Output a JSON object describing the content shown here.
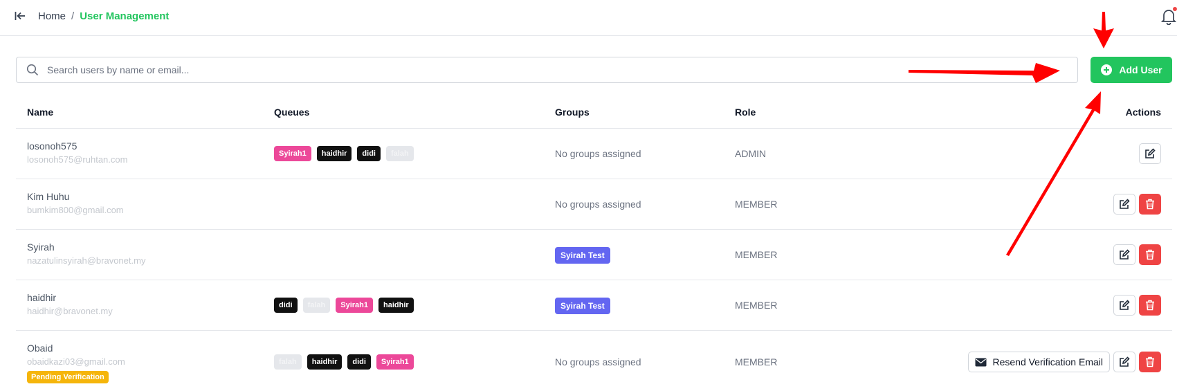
{
  "breadcrumb": {
    "home": "Home",
    "separator": "/",
    "current": "User Management"
  },
  "search": {
    "placeholder": "Search users by name or email..."
  },
  "add_user_label": "Add User",
  "columns": {
    "name": "Name",
    "queues": "Queues",
    "groups": "Groups",
    "role": "Role",
    "actions": "Actions"
  },
  "users": [
    {
      "name": "losonoh575",
      "email": "losonoh575@ruhtan.com",
      "queues": [
        "Syirah1",
        "haidhir",
        "didi",
        "falah"
      ],
      "groups": "No groups assigned",
      "role": "ADMIN"
    },
    {
      "name": "Kim Huhu",
      "email": "bumkim800@gmail.com",
      "queues": [],
      "groups": "No groups assigned",
      "role": "MEMBER"
    },
    {
      "name": "Syirah",
      "email": "nazatulinsyirah@bravonet.my",
      "queues": [],
      "groups": "Syirah Test",
      "role": "MEMBER"
    },
    {
      "name": "haidhir",
      "email": "haidhir@bravonet.my",
      "queues": [
        "didi",
        "falah",
        "Syirah1",
        "haidhir"
      ],
      "groups": "Syirah Test",
      "role": "MEMBER"
    },
    {
      "name": "Obaid",
      "email": "obaidkazi03@gmail.com",
      "status": "Pending Verification",
      "queues": [
        "falah",
        "haidhir",
        "didi",
        "Syirah1"
      ],
      "groups": "No groups assigned",
      "role": "MEMBER",
      "resend_label": "Resend Verification Email"
    }
  ],
  "colors": {
    "accent": "#22c55e",
    "danger": "#ef4444",
    "group_tag": "#6366f1",
    "queue_pink": "#ec4899",
    "queue_black": "#111111",
    "pending": "#f5b50b",
    "annotation": "#ff0000"
  },
  "icons": {
    "collapse": "arrow-left-bar-icon",
    "bell": "bell-icon",
    "search": "search-icon",
    "add": "plus-circle-icon",
    "edit": "edit-icon",
    "delete": "trash-icon",
    "email": "envelope-icon"
  }
}
